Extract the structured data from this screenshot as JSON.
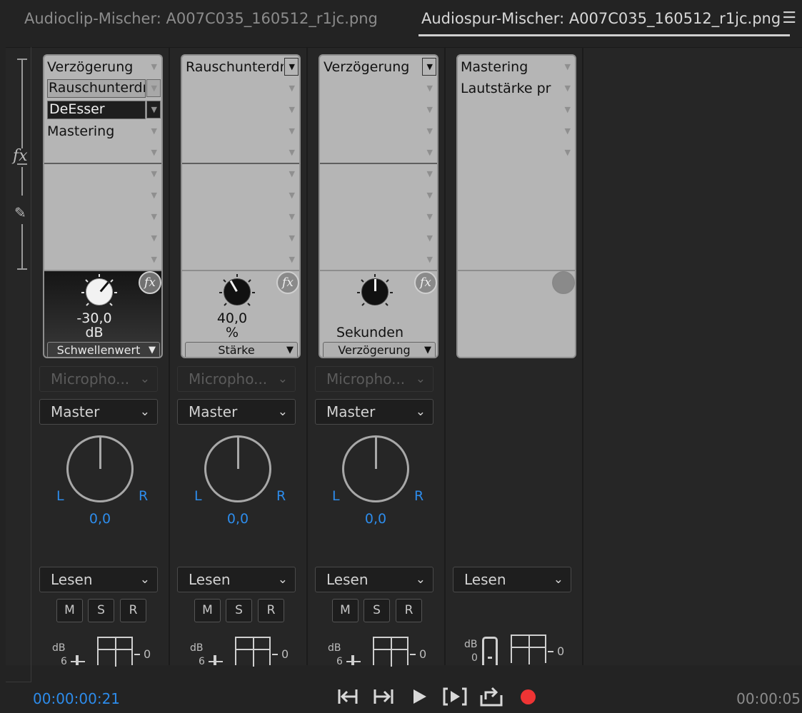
{
  "tabs": {
    "clip_mixer": "Audioclip-Mischer: A007C035_160512_r1jc.png",
    "track_mixer": "Audiospur-Mischer: A007C035_160512_r1jc.png",
    "menu_icon": "hamburger-menu-icon"
  },
  "rail": {
    "fx_label": "fx",
    "pen_icon": "pen-icon"
  },
  "strips": [
    {
      "slots": [
        "Verzögerung",
        "Rauschunterdrückung",
        "DeEsser",
        "Mastering"
      ],
      "param": {
        "value": "-30,0",
        "unit": "dB",
        "select": "Schwellenwert"
      },
      "input": "Micropho...",
      "output": "Master",
      "pan": {
        "L": "L",
        "R": "R",
        "value": "0,0"
      },
      "automation": "Lesen",
      "buttons": [
        "M",
        "S",
        "R"
      ],
      "meter": {
        "db": "dB",
        "six": "6",
        "zero": "0"
      }
    },
    {
      "slots": [
        "Rauschunterdrückung"
      ],
      "param": {
        "value": "40,0",
        "unit": "%",
        "select": "Stärke"
      },
      "input": "Micropho...",
      "output": "Master",
      "pan": {
        "L": "L",
        "R": "R",
        "value": "0,0"
      },
      "automation": "Lesen",
      "buttons": [
        "M",
        "S",
        "R"
      ],
      "meter": {
        "db": "dB",
        "six": "6",
        "zero": "0"
      }
    },
    {
      "slots": [
        "Verzögerung"
      ],
      "param": {
        "value": "",
        "unit": "Sekunden",
        "select": "Verzögerung"
      },
      "input": "Micropho...",
      "output": "Master",
      "pan": {
        "L": "L",
        "R": "R",
        "value": "0,0"
      },
      "automation": "Lesen",
      "buttons": [
        "M",
        "S",
        "R"
      ],
      "meter": {
        "db": "dB",
        "six": "6",
        "zero": "0"
      }
    },
    {
      "slots": [
        "Mastering",
        "Lautstärke pr"
      ],
      "automation": "Lesen",
      "meter": {
        "db": "dB",
        "zero_top": "0",
        "zero": "0"
      }
    }
  ],
  "transport": {
    "current_time": "00:00:00:21",
    "duration": "00:00:05",
    "buttons": [
      "go-to-in-point-icon",
      "go-to-out-point-icon",
      "play-icon",
      "play-in-to-out-icon",
      "loop-icon",
      "record-icon"
    ]
  },
  "colors": {
    "timecode": "#2d8ceb",
    "record": "#ee3434",
    "rack": "#b5b5b5"
  }
}
